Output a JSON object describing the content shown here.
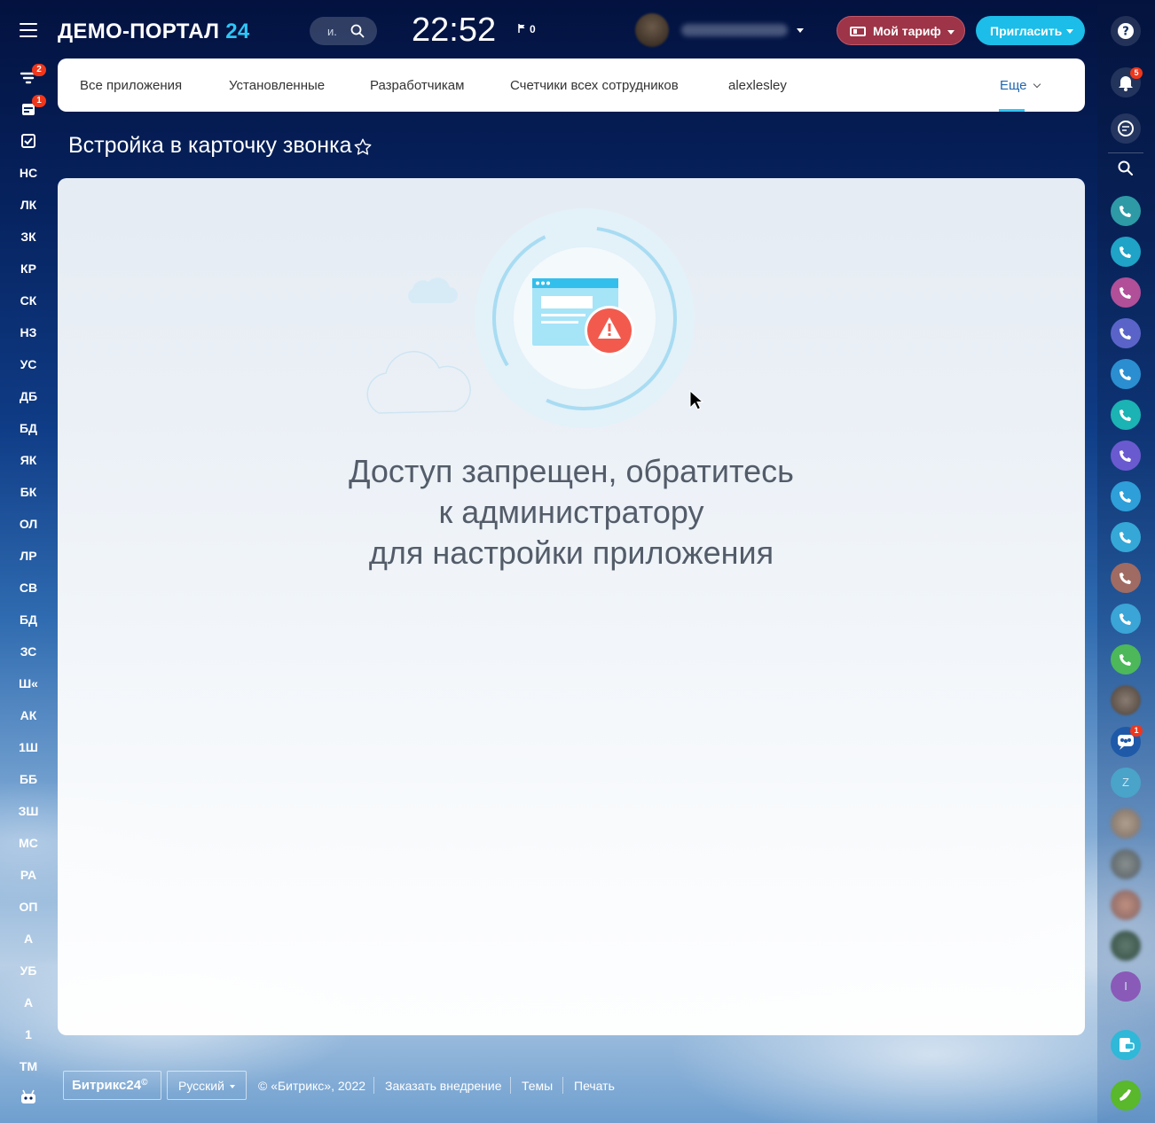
{
  "header": {
    "logo_text": "ДЕМО-ПОРТАЛ",
    "logo_number": "24",
    "search_text": "и.",
    "clock": "22:52",
    "flag_count": "0",
    "tariff_label": "Мой тариф",
    "invite_label": "Пригласить"
  },
  "left_menu": {
    "badge_filter": "2",
    "badge_calendar": "1",
    "items": [
      "НС",
      "ЛК",
      "ЗК",
      "КР",
      "СК",
      "НЗ",
      "УС",
      "ДБ",
      "БД",
      "ЯК",
      "БК",
      "ОЛ",
      "ЛР",
      "СВ",
      "БД",
      "ЗС",
      "Ш«",
      "АК",
      "1Ш",
      "ББ",
      "ЗШ",
      "МС",
      "РА",
      "ОП",
      "А",
      "УБ",
      "А",
      "1",
      "ТМ"
    ]
  },
  "tabs": {
    "items": [
      "Все приложения",
      "Установленные",
      "Разработчикам",
      "Счетчики всех сотрудников",
      "alexlesley"
    ],
    "more": "Еще"
  },
  "page": {
    "title": "Встройка в карточку звонка",
    "message_line1": "Доступ запрещен, обратитесь",
    "message_line2": "к администратору",
    "message_line3": "для настройки приложения"
  },
  "footer": {
    "logo": "Битрикс24",
    "logo_mark": "©",
    "language": "Русский",
    "copyright": "© «Битрикс», 2022",
    "order_link": "Заказать внедрение",
    "themes_link": "Темы",
    "print_link": "Печать"
  },
  "right_bar": {
    "notifications_badge": "5",
    "chat_badge": "1",
    "letter_z": "Z",
    "letter_i": "I"
  },
  "colors": {
    "accent": "#2fc6f6",
    "tariff": "#9d3447",
    "invite": "#1cbde8",
    "badge": "#f0371b",
    "message": "#535c69"
  }
}
